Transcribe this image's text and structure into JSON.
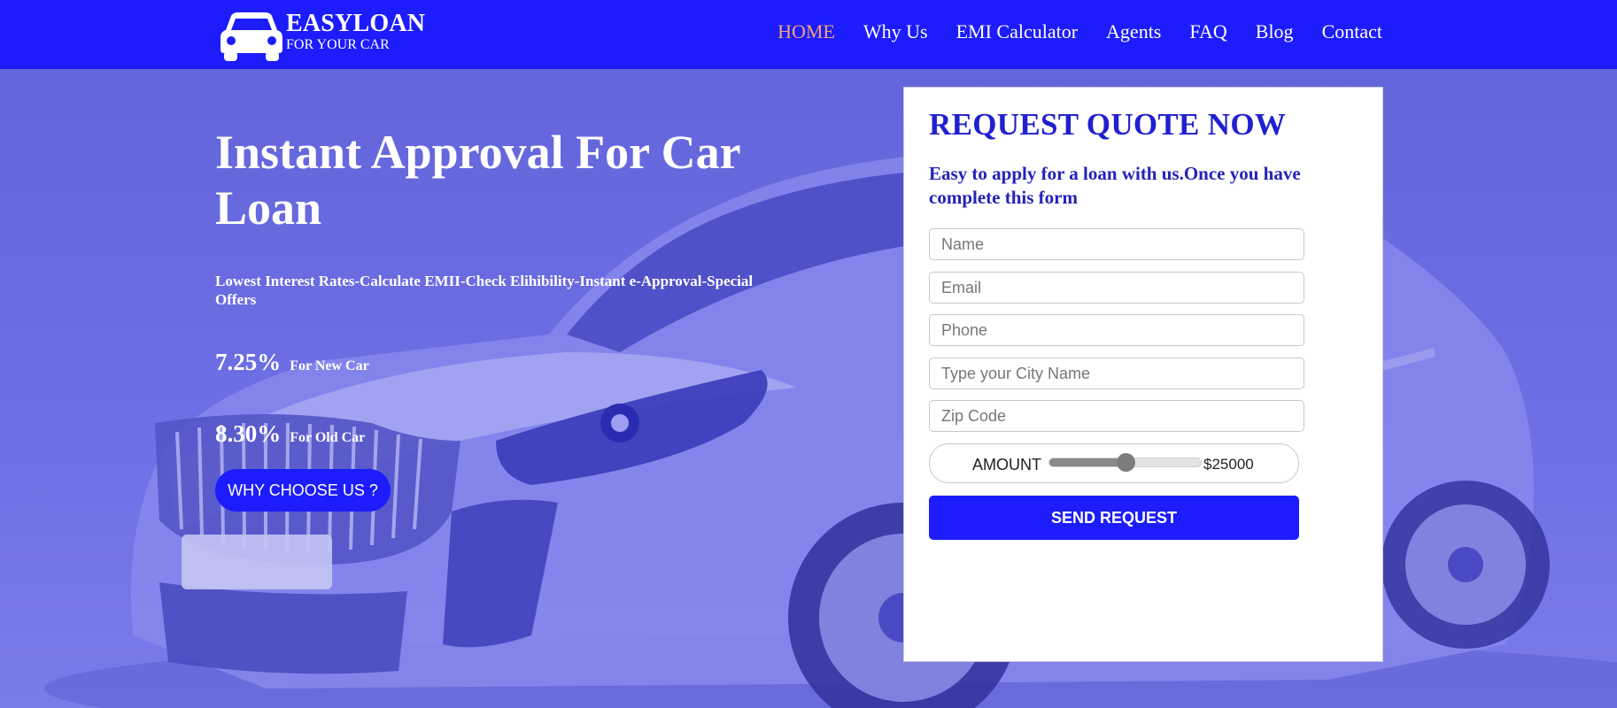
{
  "brand": {
    "name": "EASYLOAN",
    "tagline": "FOR YOUR CAR",
    "logo_icon": "car-icon"
  },
  "nav": {
    "items": [
      {
        "label": "HOME",
        "active": true
      },
      {
        "label": "Why Us",
        "active": false
      },
      {
        "label": "EMI Calculator",
        "active": false
      },
      {
        "label": "Agents",
        "active": false
      },
      {
        "label": "FAQ",
        "active": false
      },
      {
        "label": "Blog",
        "active": false
      },
      {
        "label": "Contact",
        "active": false
      }
    ]
  },
  "hero": {
    "title": "Instant Approval For Car Loan",
    "subtitle": "Lowest Interest Rates-Calculate EMII-Check Elihibility-Instant e-Approval-Special Offers",
    "rates": [
      {
        "value": "7.25%",
        "label": "For New Car"
      },
      {
        "value": "8.30%",
        "label": "For Old Car"
      }
    ],
    "cta_label": "WHY CHOOSE US ?"
  },
  "form": {
    "title": "REQUEST QUOTE NOW",
    "description": "Easy to apply for a loan with us.Once you have complete this form",
    "fields": {
      "name_placeholder": "Name",
      "email_placeholder": "Email",
      "phone_placeholder": "Phone",
      "city_placeholder": "Type your City Name",
      "zip_placeholder": "Zip Code"
    },
    "amount": {
      "label": "AMOUNT",
      "display": "$25000",
      "slider_fraction": 0.5
    },
    "submit_label": "SEND REQUEST"
  },
  "colors": {
    "primary": "#1c1cfc",
    "nav_active": "#f4a27a",
    "hero_overlay": "#6d6ee6",
    "form_heading": "#2020d0"
  }
}
